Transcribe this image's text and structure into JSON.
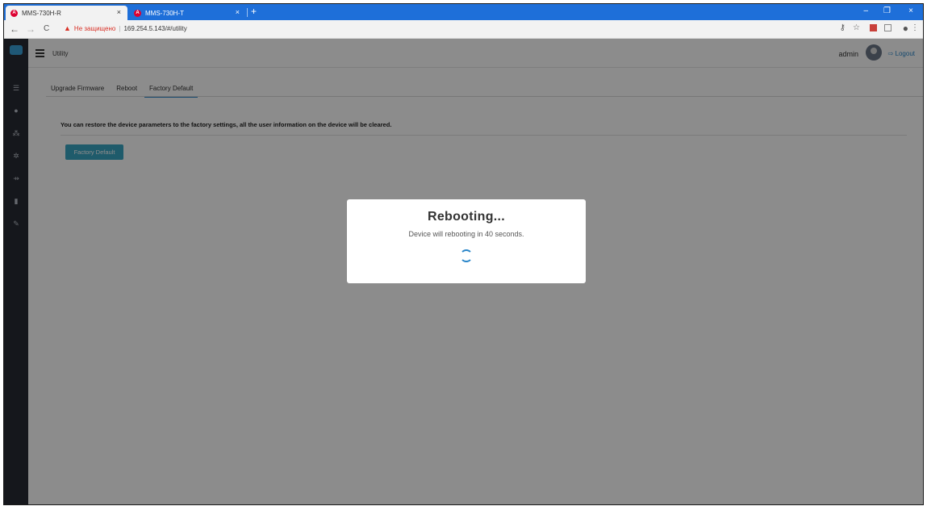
{
  "browser": {
    "tabs": [
      {
        "title": "MMS-730H-R"
      },
      {
        "title": "MMS-730H-T"
      }
    ],
    "favicon_letter": "A",
    "tab_close": "×",
    "new_tab": "+",
    "window_controls": {
      "minimize": "–",
      "restore": "❐",
      "close": "×"
    },
    "nav": {
      "back": "←",
      "forward": "→",
      "reload": "C"
    },
    "address": {
      "security_label": "Не защищено",
      "url": "169.254.5.143/#/utility"
    }
  },
  "app": {
    "title": "Utility",
    "user": "admin",
    "logout_label": "Logout",
    "sidebar_icons": [
      "list-icon",
      "user-icon",
      "network-icon",
      "gear-icon",
      "usb-icon",
      "storage-icon",
      "wrench-icon"
    ],
    "tabs": [
      {
        "label": "Upgrade Firmware"
      },
      {
        "label": "Reboot"
      },
      {
        "label": "Factory Default"
      }
    ],
    "notice": "You can restore the device parameters to the factory settings, all the user information on the device will be cleared.",
    "factory_default_button": "Factory Default"
  },
  "modal": {
    "title": "Rebooting...",
    "message": "Device will rebooting in 40 seconds."
  },
  "colors": {
    "chrome_blue": "#1e6fd9",
    "sidebar": "#272b33",
    "accent": "#2a86c9",
    "button": "#3aa6c3"
  }
}
